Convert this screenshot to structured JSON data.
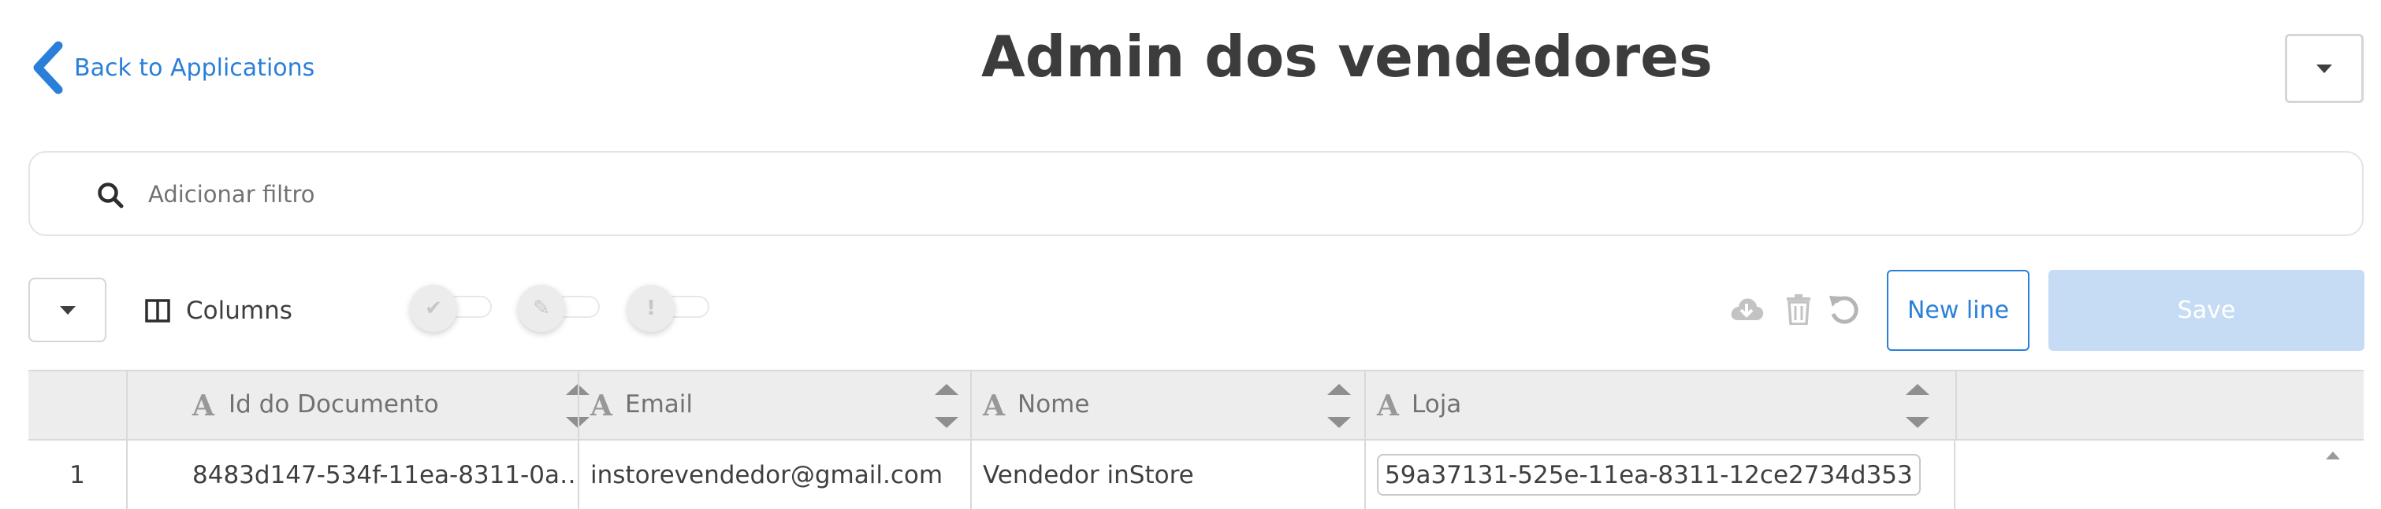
{
  "header": {
    "back_label": "Back to Applications",
    "title": "Admin dos vendedores"
  },
  "search": {
    "placeholder": "Adicionar filtro",
    "value": ""
  },
  "toolbar": {
    "columns_label": "Columns",
    "toggles": [
      "check-icon",
      "pencil-icon",
      "exclamation-icon"
    ],
    "actions": [
      "cloud-download-icon",
      "trash-icon",
      "undo-icon"
    ],
    "new_line_label": "New line",
    "save_label": "Save"
  },
  "table": {
    "column_type_icon": "A",
    "columns": [
      "Id do Documento",
      "Email",
      "Nome",
      "Loja"
    ],
    "rows": [
      {
        "num": "1",
        "cells": [
          "8483d147-534f-11ea-8311-0a…",
          "instorevendedor@gmail.com",
          "Vendedor inStore",
          "59a37131-525e-11ea-8311-12ce2734d353"
        ]
      }
    ]
  },
  "colors": {
    "accent": "#2a7fd8",
    "save_disabled": "#c6dcf4",
    "header_bg": "#ededed",
    "border": "#d9d9d9"
  }
}
